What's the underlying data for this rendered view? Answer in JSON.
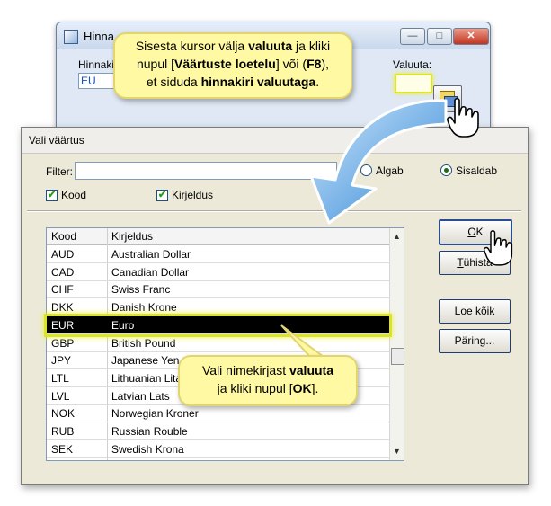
{
  "background_window": {
    "title": "Hinna",
    "label_hinnakiri": "Hinnaki",
    "hinnakiri_value": "EU",
    "label_valuuta": "Valuuta:"
  },
  "dialog": {
    "title": "Vali väärtus",
    "filter_label": "Filter:",
    "filter_value": "",
    "radio_algab": "Algab",
    "radio_sisaldab": "Sisaldab",
    "radio_selected": "Sisaldab",
    "check_kood": "Kood",
    "check_kirjeldus": "Kirjeldus",
    "columns": [
      "Kood",
      "Kirjeldus"
    ],
    "rows": [
      {
        "code": "AUD",
        "desc": "Australian Dollar"
      },
      {
        "code": "CAD",
        "desc": "Canadian Dollar"
      },
      {
        "code": "CHF",
        "desc": "Swiss Franc"
      },
      {
        "code": "DKK",
        "desc": "Danish Krone"
      },
      {
        "code": "EUR",
        "desc": "Euro"
      },
      {
        "code": "GBP",
        "desc": "British Pound"
      },
      {
        "code": "JPY",
        "desc": "Japanese Yen"
      },
      {
        "code": "LTL",
        "desc": "Lithuanian Lita"
      },
      {
        "code": "LVL",
        "desc": "Latvian Lats"
      },
      {
        "code": "NOK",
        "desc": "Norwegian Kroner"
      },
      {
        "code": "RUB",
        "desc": "Russian Rouble"
      },
      {
        "code": "SEK",
        "desc": "Swedish Krona"
      }
    ],
    "selected_code": "EUR",
    "buttons": {
      "ok_prefix": "O",
      "ok_rest": "K",
      "cancel_prefix": "T",
      "cancel_rest": "ühista",
      "load_all": "Loe kõik",
      "query": "Päring..."
    }
  },
  "callouts": {
    "top": {
      "l1a": "Sisesta kursor välja ",
      "l1b": "valuuta",
      "l1c": " ja kliki",
      "l2a": "nupul [",
      "l2b": "Väärtuste loetelu",
      "l2c": "] või (",
      "l2d": "F8",
      "l2e": "),",
      "l3a": "et siduda ",
      "l3b": "hinnakiri valuutaga",
      "l3c": "."
    },
    "bottom": {
      "l1a": "Vali nimekirjast ",
      "l1b": "valuuta",
      "l2a": "ja kliki nupul [",
      "l2b": "OK",
      "l2c": "]."
    }
  },
  "colors": {
    "highlight": "#dbe427",
    "callout_bg": "#fff9a3",
    "arrow": "#3c8fd6"
  }
}
